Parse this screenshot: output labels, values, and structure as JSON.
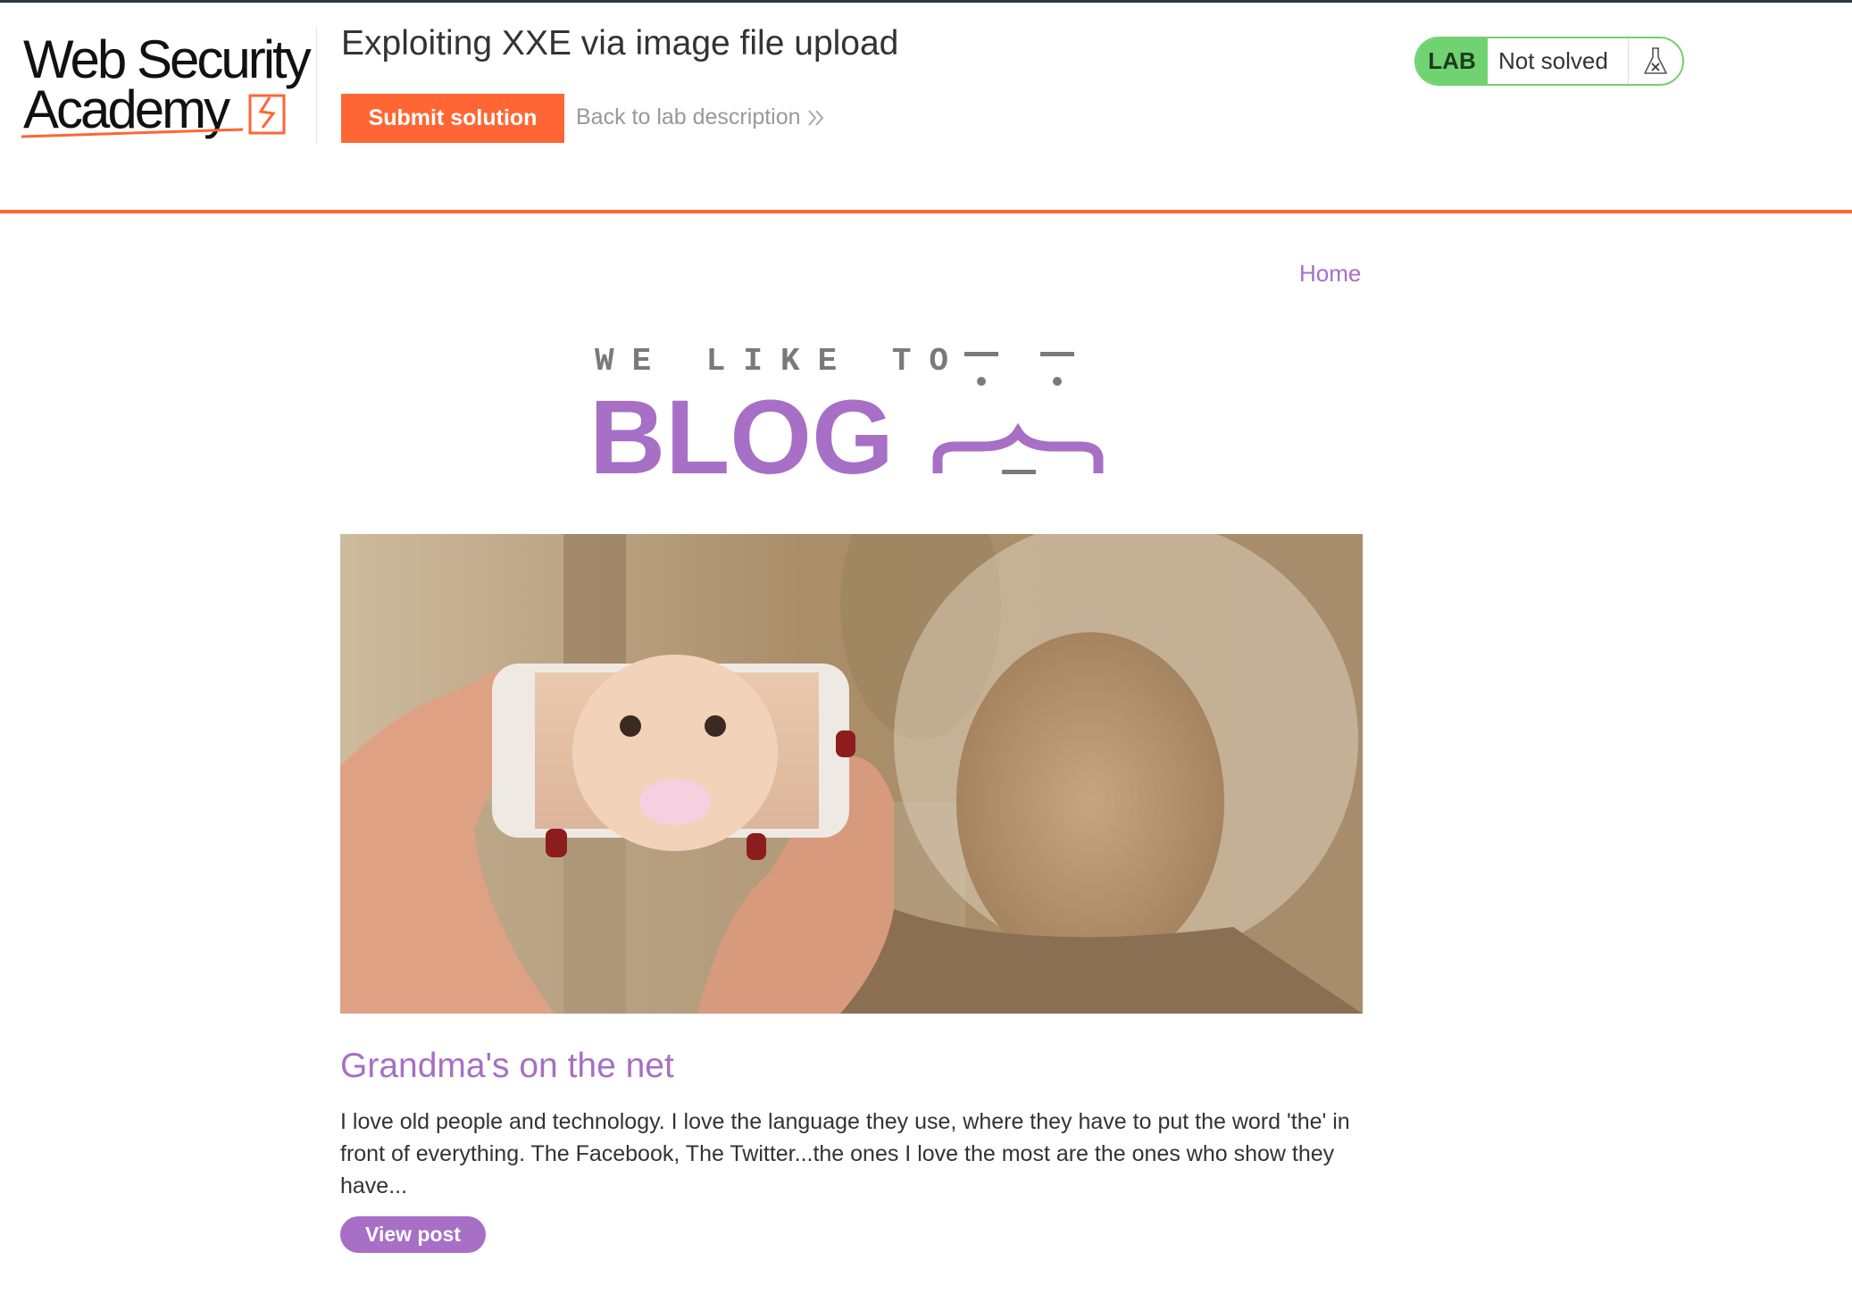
{
  "header": {
    "logo": {
      "line1": "Web Security",
      "line2": "Academy",
      "icon": "academy-bolt-icon"
    },
    "lab_title": "Exploiting XXE via image file upload",
    "submit_label": "Submit solution",
    "back_label": "Back to lab description",
    "back_icon": "double-chevron-right-icon",
    "status": {
      "badge": "LAB",
      "state": "Not solved",
      "icon": "flask-icon"
    }
  },
  "nav": {
    "home_label": "Home"
  },
  "blog": {
    "logo": {
      "line1": "WE LIKE TO",
      "line2": "BLOG"
    },
    "posts": [
      {
        "title": "Grandma's on the net",
        "excerpt": "I love old people and technology. I love the language they use, where they have to put the word 'the' in front of everything. The Facebook, The Twitter...the ones I love the most are the ones who show they have...",
        "button": "View post"
      }
    ]
  },
  "colors": {
    "accent_orange": "#ff6633",
    "blog_purple": "#a76fc5",
    "lab_green": "#70d270"
  }
}
